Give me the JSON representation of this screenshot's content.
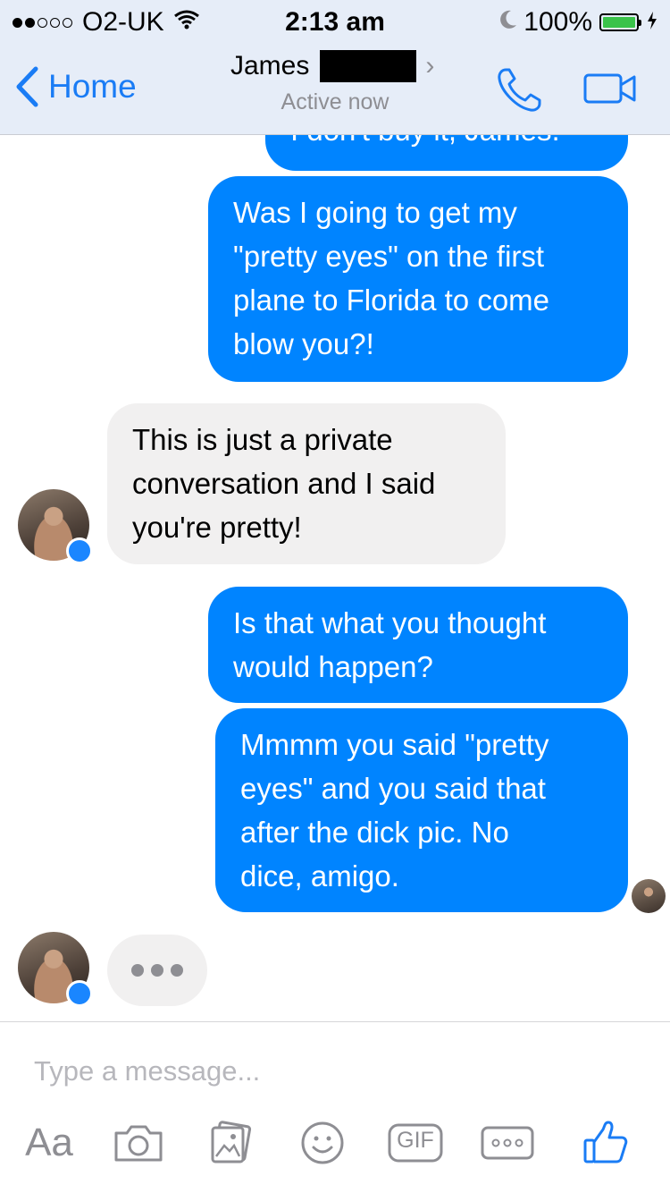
{
  "status_bar": {
    "carrier": "O2-UK",
    "time": "2:13 am",
    "battery": "100%",
    "signal_bars_filled": 2,
    "signal_bars_total": 5
  },
  "nav": {
    "back_label": "Home",
    "contact_name": "James",
    "status": "Active now"
  },
  "messages": [
    {
      "side": "out",
      "lines": [
        "I don't buy it, James."
      ]
    },
    {
      "side": "out",
      "lines": [
        "Was I going to get my",
        "\"pretty eyes\" on the first",
        "plane to Florida to come",
        "blow you?!"
      ]
    },
    {
      "side": "in",
      "lines": [
        "This is just a private",
        "conversation and I said",
        "you're pretty!"
      ]
    },
    {
      "side": "out",
      "lines": [
        "Is that what you thought",
        "would happen?"
      ]
    },
    {
      "side": "out",
      "lines": [
        "Mmmm you said \"pretty",
        "eyes\" and you said that",
        "after the dick pic. No",
        "dice, amigo."
      ]
    }
  ],
  "composer": {
    "placeholder": "Type a message...",
    "aa_label": "Aa",
    "gif_label": "GIF"
  },
  "icons": [
    "back-chevron-icon",
    "phone-icon",
    "video-camera-icon",
    "camera-icon",
    "gallery-icon",
    "emoji-icon",
    "gif-icon",
    "more-icon",
    "thumbs-up-icon",
    "messenger-badge-icon",
    "wifi-icon",
    "moon-icon",
    "battery-icon",
    "charging-icon"
  ],
  "colors": {
    "accent": "#0084ff",
    "link": "#1a7cf5",
    "incoming_bubble": "#f1f0f0",
    "header_bg": "#e6edf8"
  }
}
